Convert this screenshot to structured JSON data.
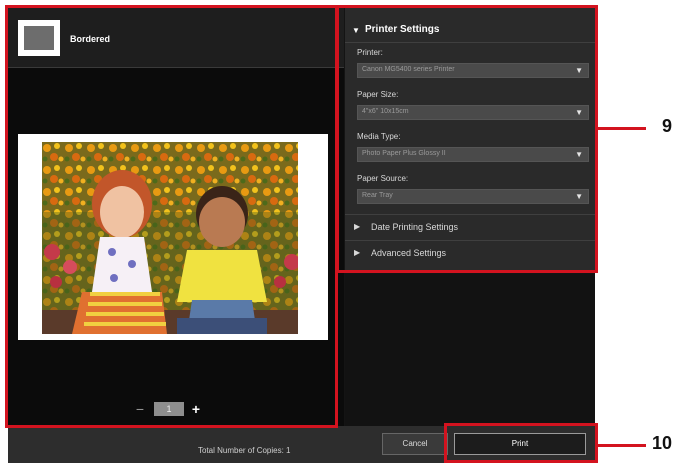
{
  "layout": {
    "label": "Bordered"
  },
  "copy_stepper": {
    "minus": "−",
    "count": "1",
    "plus": "+"
  },
  "printer_settings": {
    "title": "Printer Settings",
    "fields": [
      {
        "label": "Printer:",
        "value": "Canon MG5400 series Printer"
      },
      {
        "label": "Paper Size:",
        "value": "4\"x6\" 10x15cm"
      },
      {
        "label": "Media Type:",
        "value": "Photo Paper Plus Glossy II"
      },
      {
        "label": "Paper Source:",
        "value": "Rear Tray"
      }
    ]
  },
  "sections": {
    "date_printing": "Date Printing Settings",
    "advanced": "Advanced Settings"
  },
  "bottom": {
    "total_copies": "Total Number of Copies:  1",
    "cancel": "Cancel",
    "print": "Print"
  },
  "callouts": {
    "settings_number": "9",
    "print_number": "10"
  },
  "colors": {
    "highlight": "#d3131f",
    "panel": "#2a2a2a",
    "background": "#141414"
  }
}
